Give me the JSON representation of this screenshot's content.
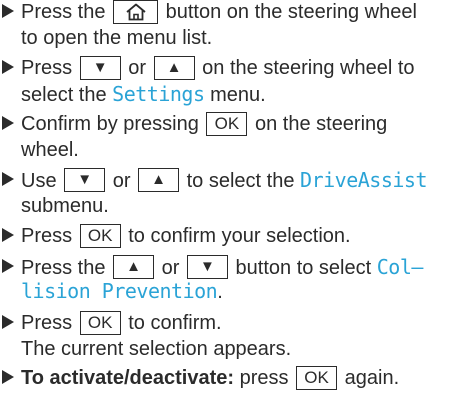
{
  "steps": [
    {
      "line1": {
        "pre": "Press the",
        "key": "home-icon",
        "post": "button on the steering wheel"
      },
      "line2": "to open the menu list."
    },
    {
      "line1": {
        "pre": "Press",
        "key1": "▼",
        "mid": "or",
        "key2": "▲",
        "post": "on the steering wheel to"
      },
      "line2": {
        "pre": "select the",
        "display": "Settings",
        "post": "menu."
      }
    },
    {
      "line1": {
        "pre": "Confirm by pressing",
        "key": "OK",
        "post": "on the steering"
      },
      "line2": "wheel."
    },
    {
      "line1": {
        "pre": "Use",
        "key1": "▼",
        "mid": "or",
        "key2": "▲",
        "post": "to select the",
        "display": "DriveAssist"
      },
      "line2": "submenu."
    },
    {
      "line1": {
        "pre": "Press",
        "key": "OK",
        "post": "to confirm your selection."
      }
    },
    {
      "line1": {
        "pre": "Press the",
        "key1": "▲",
        "mid": "or",
        "key2": "▼",
        "post": "button to select",
        "display": "Col–"
      },
      "line2": {
        "display": "lision Prevention",
        "post": "."
      }
    },
    {
      "line1": {
        "pre": "Press",
        "key": "OK",
        "post": "to confirm."
      },
      "line2": "The current selection appears."
    },
    {
      "line1": {
        "bold": "To activate/deactivate:",
        "pre": "press",
        "key": "OK",
        "post": "again."
      }
    }
  ],
  "colors": {
    "text": "#2b2b2b",
    "display_text": "#2aa3d6"
  }
}
